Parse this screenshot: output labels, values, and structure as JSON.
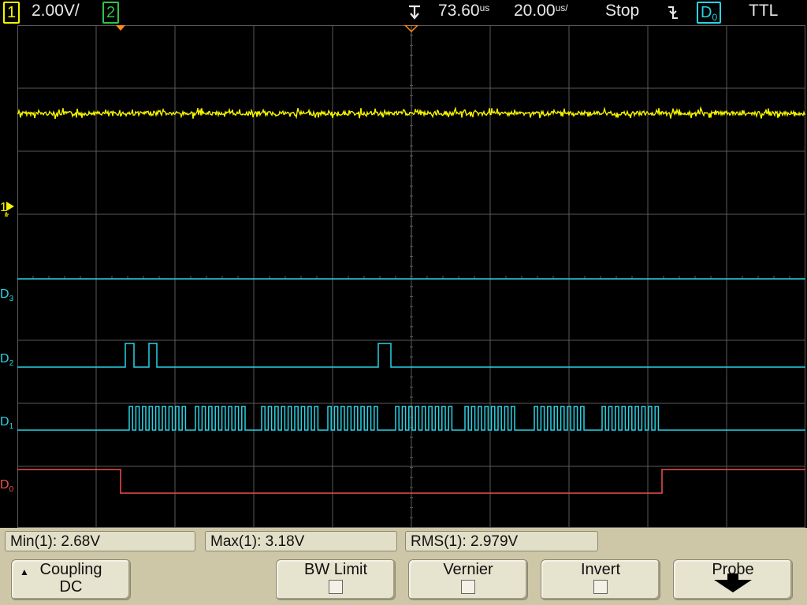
{
  "topbar": {
    "ch1_number": "1",
    "ch1_scale": "2.00V/",
    "ch2_number": "2",
    "time_delay": "73.60",
    "time_delay_unit": "us",
    "time_scale": "20.00",
    "time_scale_unit": "us/",
    "run_state": "Stop",
    "trigger_slope_icon": "falling-edge-icon",
    "trigger_source_letter": "D",
    "trigger_source_sub": "0",
    "trigger_level": "TTL"
  },
  "channels": {
    "ch1_marker": "1",
    "d3_letter": "D",
    "d3_sub": "3",
    "d2_letter": "D",
    "d2_sub": "2",
    "d1_letter": "D",
    "d1_sub": "1",
    "d0_letter": "D",
    "d0_sub": "0"
  },
  "colors": {
    "ch1": "#f4f400",
    "digital": "#29d3e6",
    "d0": "#f05050",
    "grid": "#5a5a5a",
    "panel": "#cdc7a8"
  },
  "measurements": [
    {
      "label": "Min(1): 2.68V"
    },
    {
      "label": "Max(1): 3.18V"
    },
    {
      "label": "RMS(1): 2.979V"
    }
  ],
  "softkeys": {
    "coupling_label": "Coupling",
    "coupling_value": "DC",
    "bw_limit_label": "BW Limit",
    "vernier_label": "Vernier",
    "invert_label": "Invert",
    "probe_label": "Probe"
  }
}
